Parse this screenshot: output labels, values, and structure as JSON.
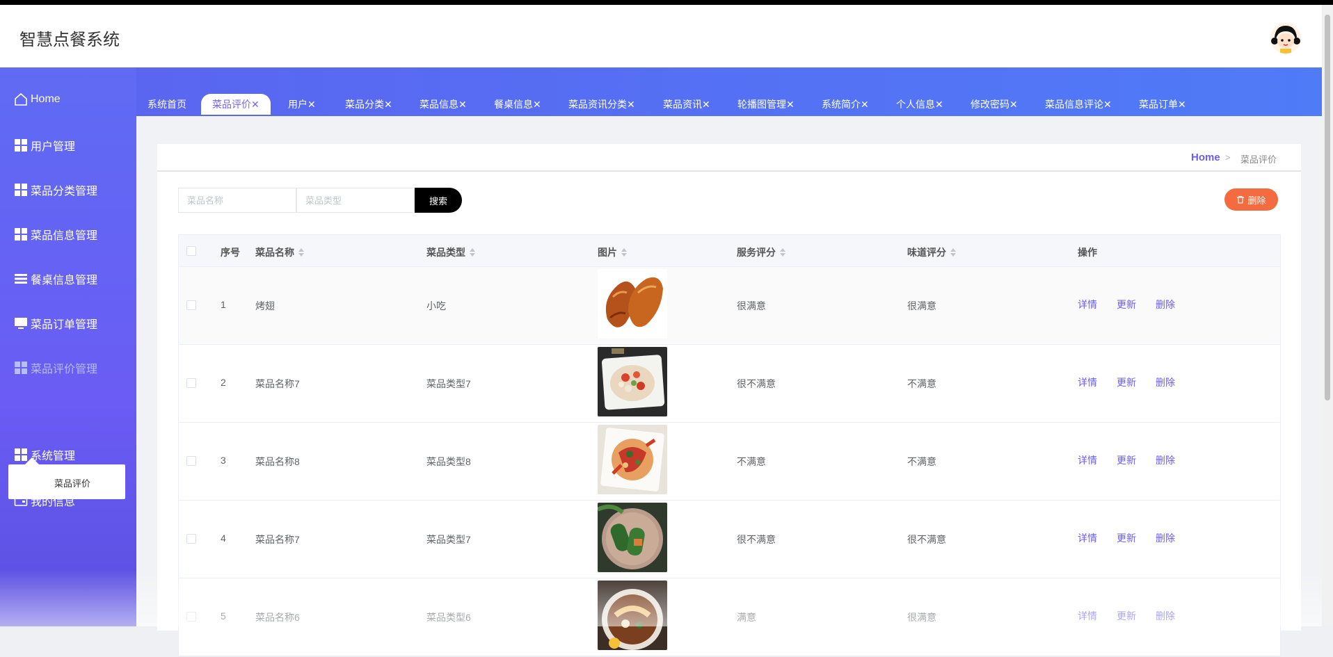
{
  "app": {
    "title": "智慧点餐系统"
  },
  "sidebar": {
    "home_label": "Home",
    "items": [
      {
        "label": "用户管理",
        "icon": "grid-icon"
      },
      {
        "label": "菜品分类管理",
        "icon": "grid-icon"
      },
      {
        "label": "菜品信息管理",
        "icon": "grid-icon"
      },
      {
        "label": "餐桌信息管理",
        "icon": "list-icon"
      },
      {
        "label": "菜品订单管理",
        "icon": "monitor-icon"
      },
      {
        "label": "菜品评价管理",
        "icon": "grid-icon",
        "active": true
      },
      {
        "label": "系统管理",
        "icon": "grid-icon"
      },
      {
        "label": "我的信息",
        "icon": "wallet-icon"
      }
    ],
    "submenu_item": "菜品评价"
  },
  "tabs": [
    {
      "label": "系统首页"
    },
    {
      "label": "菜品评价✕",
      "active": true
    },
    {
      "label": "用户✕"
    },
    {
      "label": "菜品分类✕"
    },
    {
      "label": "菜品信息✕"
    },
    {
      "label": "餐桌信息✕"
    },
    {
      "label": "菜品资讯分类✕"
    },
    {
      "label": "菜品资讯✕"
    },
    {
      "label": "轮播图管理✕"
    },
    {
      "label": "系统简介✕"
    },
    {
      "label": "个人信息✕"
    },
    {
      "label": "修改密码✕"
    },
    {
      "label": "菜品信息评论✕"
    },
    {
      "label": "菜品订单✕"
    }
  ],
  "breadcrumb": {
    "home": "Home",
    "separator": ">",
    "current": "菜品评价"
  },
  "search": {
    "name_placeholder": "菜品名称",
    "type_placeholder": "菜品类型",
    "button_label": "搜索"
  },
  "delete_button_label": "删除",
  "table": {
    "headers": {
      "index": "序号",
      "name": "菜品名称",
      "type": "菜品类型",
      "image": "图片",
      "service": "服务评分",
      "taste": "味道评分",
      "actions": "操作"
    },
    "rows": [
      {
        "index": "1",
        "name": "烤翅",
        "type": "小吃",
        "service": "很满意",
        "taste": "很满意"
      },
      {
        "index": "2",
        "name": "菜品名称7",
        "type": "菜品类型7",
        "service": "很不满意",
        "taste": "不满意"
      },
      {
        "index": "3",
        "name": "菜品名称8",
        "type": "菜品类型8",
        "service": "不满意",
        "taste": "不满意"
      },
      {
        "index": "4",
        "name": "菜品名称7",
        "type": "菜品类型7",
        "service": "很不满意",
        "taste": "很不满意"
      },
      {
        "index": "5",
        "name": "菜品名称6",
        "type": "菜品类型6",
        "service": "满意",
        "taste": "很满意"
      }
    ],
    "row_actions": {
      "detail": "详情",
      "update": "更新",
      "delete": "删除"
    }
  },
  "colors": {
    "accent": "#6a5cf4",
    "sidebar": "#5f6bf3",
    "delete": "#f46b3f"
  }
}
